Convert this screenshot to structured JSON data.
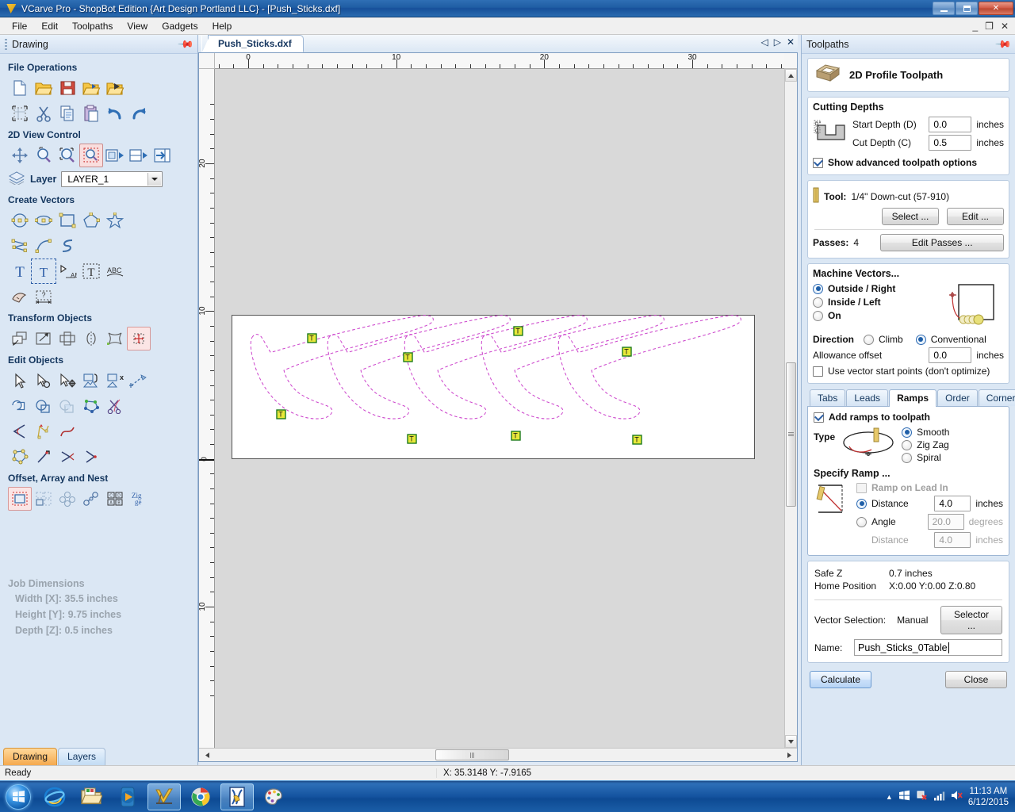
{
  "window": {
    "title": "VCarve Pro - ShopBot Edition {Art Design Portland LLC} - [Push_Sticks.dxf]",
    "minimize_label": "Minimize",
    "maximize_label": "Restore",
    "close_label": "Close",
    "inner_minimize": "_",
    "inner_restore": "❐",
    "inner_close": "✕"
  },
  "menu": {
    "items": [
      {
        "label": "File"
      },
      {
        "label": "Edit"
      },
      {
        "label": "Toolpaths"
      },
      {
        "label": "View"
      },
      {
        "label": "Gadgets"
      },
      {
        "label": "Help"
      }
    ]
  },
  "left_panel": {
    "title": "Drawing",
    "pin_label": "Pin panel",
    "sections": [
      {
        "title": "File Operations",
        "rows": [
          [
            "new-file-icon",
            "open-file-icon",
            "save-file-icon",
            "import-file-icon",
            "export-file-icon"
          ],
          [
            "job-setup-icon",
            "cut-icon",
            "copy-icon",
            "paste-icon",
            "undo-icon",
            "redo-icon"
          ]
        ]
      },
      {
        "title": "2D View Control",
        "rows": [
          [
            "pan-icon",
            "zoom-interactive-icon",
            "zoom-extents-icon",
            "zoom-box-icon",
            "zoom-selected-icon",
            "toggle-2d-3d-icon",
            "show-hide-panel-icon"
          ]
        ]
      },
      {
        "title": "Create Vectors",
        "rows": [
          [
            "draw-circle-icon",
            "draw-ellipse-icon",
            "draw-rectangle-icon",
            "draw-polygon-icon",
            "draw-star-icon"
          ],
          [
            "draw-polyline-icon",
            "draw-curve-icon",
            "draw-freehand-icon"
          ],
          [
            "create-text-icon",
            "edit-text-icon",
            "text-on-curve-icon",
            "text-block-icon",
            "auto-layout-text-icon"
          ],
          [
            "trace-bitmap-icon",
            "dimension-icon"
          ]
        ]
      },
      {
        "title": "Transform Objects",
        "rows": [
          [
            "move-objects-icon",
            "scale-objects-icon",
            "rotate-objects-icon",
            "mirror-objects-icon",
            "distort-objects-icon",
            "align-objects-icon"
          ]
        ]
      },
      {
        "title": "Edit Objects",
        "rows": [
          [
            "node-edit-icon",
            "node-edit-tools-icon",
            "move-node-icon",
            "group-objects-icon",
            "ungroup-objects-icon",
            "join-vectors-icon"
          ],
          [
            "weld-vectors-icon",
            "subtract-vectors-icon",
            "intersect-vectors-icon",
            "close-vector-icon",
            "trim-vectors-icon"
          ],
          [
            "fillet-icon",
            "curve-fit-icon",
            "smooth-curve-icon"
          ],
          [
            "offset-contour-icon",
            "corner-tool-1-icon",
            "corner-tool-2-icon",
            "corner-tool-3-icon"
          ]
        ]
      },
      {
        "title": "Offset, Array and Nest",
        "rows": [
          [
            "offset-vectors-icon",
            "block-copy-icon",
            "circular-copy-icon",
            "rotate-copy-icon",
            "plate-layout-icon",
            "nesting-icon"
          ]
        ]
      }
    ],
    "layer": {
      "label": "Layer",
      "icon": "layers-icon",
      "value": "LAYER_1",
      "options": [
        "LAYER_1"
      ]
    },
    "job_dimensions": {
      "title": "Job Dimensions",
      "lines": [
        "Width  [X]: 35.5 inches",
        "Height [Y]: 9.75 inches",
        "Depth  [Z]: 0.5 inches"
      ]
    },
    "tabs": [
      {
        "label": "Drawing",
        "active": true
      },
      {
        "label": "Layers",
        "active": false
      }
    ]
  },
  "document": {
    "tab_label": "Push_Sticks.dxf",
    "nav": {
      "prev": "◁",
      "next": "▷",
      "close": "✕"
    },
    "ruler_h": {
      "labels": [
        "0",
        "10",
        "20",
        "30"
      ],
      "label_positions": [
        0,
        10,
        20,
        30
      ],
      "min": -0.5,
      "max": 38
    },
    "ruler_v": {
      "labels": [
        "20",
        "10",
        "0",
        "10"
      ],
      "label_positions": [
        20,
        10,
        0,
        -10
      ]
    },
    "material": {
      "width_in": 35.5,
      "height_in": 9.75
    }
  },
  "toolpaths": {
    "title": "Toolpaths",
    "pin_label": "Pin panel",
    "header": {
      "icon": "profile-toolpath-icon",
      "name": "2D Profile Toolpath"
    },
    "cutting_depths": {
      "title": "Cutting Depths",
      "icon": "cut-depth-diagram-icon",
      "start_depth_label": "Start Depth (D)",
      "start_depth_value": "0.0",
      "start_depth_unit": "inches",
      "cut_depth_label": "Cut Depth (C)",
      "cut_depth_value": "0.5",
      "cut_depth_unit": "inches",
      "advanced_label": "Show advanced toolpath options",
      "advanced_checked": true
    },
    "tool": {
      "icon": "tool-bit-icon",
      "label": "Tool:",
      "name": "1/4\" Down-cut (57-910)",
      "select_button": "Select ...",
      "edit_button": "Edit ...",
      "passes_label": "Passes:",
      "passes_value": "4",
      "edit_passes_button": "Edit Passes ..."
    },
    "machine_vectors": {
      "title": "Machine Vectors...",
      "options": [
        {
          "label": "Outside / Right",
          "selected": true
        },
        {
          "label": "Inside / Left",
          "selected": false
        },
        {
          "label": "On",
          "selected": false
        }
      ],
      "direction_label": "Direction",
      "directions": [
        {
          "label": "Climb",
          "selected": false
        },
        {
          "label": "Conventional",
          "selected": true
        }
      ],
      "allowance_label": "Allowance offset",
      "allowance_value": "0.0",
      "allowance_unit": "inches",
      "start_points_label": "Use vector start points (don't optimize)",
      "start_points_checked": false,
      "diagram_icon": "vector-direction-diagram-icon"
    },
    "tabs": [
      {
        "label": "Tabs",
        "active": false
      },
      {
        "label": "Leads",
        "active": false
      },
      {
        "label": "Ramps",
        "active": true
      },
      {
        "label": "Order",
        "active": false
      },
      {
        "label": "Corners",
        "active": false
      }
    ],
    "ramps": {
      "add_ramps_label": "Add ramps to toolpath",
      "add_ramps_checked": true,
      "type_label": "Type",
      "type_icon": "ramp-type-diagram-icon",
      "types": [
        {
          "label": "Smooth",
          "selected": true
        },
        {
          "label": "Zig Zag",
          "selected": false
        },
        {
          "label": "Spiral",
          "selected": false
        }
      ],
      "specify_label": "Specify Ramp ...",
      "specify_icon": "ramp-distance-diagram-icon",
      "lead_in_label": "Ramp on Lead In",
      "lead_in_checked": false,
      "lead_in_disabled": true,
      "distance_label": "Distance",
      "distance_selected": true,
      "distance_value": "4.0",
      "distance_unit": "inches",
      "angle_label": "Angle",
      "angle_selected": false,
      "angle_value": "20.0",
      "angle_unit": "degrees",
      "angle_distance_label": "Distance",
      "angle_distance_value": "4.0",
      "angle_distance_unit": "inches"
    },
    "info": {
      "safe_z_label": "Safe Z",
      "safe_z_value": "0.7 inches",
      "home_label": "Home Position",
      "home_value": "X:0.00 Y:0.00 Z:0.80",
      "vector_selection_label": "Vector Selection:",
      "vector_selection_value": "Manual",
      "selector_button": "Selector ...",
      "name_label": "Name:",
      "name_value": "Push_Sticks_0Table"
    },
    "calculate_button": "Calculate",
    "close_button": "Close"
  },
  "statusbar": {
    "message": "Ready",
    "coordinates": "X: 35.3148 Y: -7.9165"
  },
  "taskbar": {
    "start_label": "start-orb-icon",
    "items": [
      {
        "name": "internet-explorer-icon",
        "active": false
      },
      {
        "name": "file-explorer-icon",
        "active": false
      },
      {
        "name": "media-player-icon",
        "active": false
      },
      {
        "name": "vcarve-pro-icon",
        "active": true
      },
      {
        "name": "google-chrome-icon",
        "active": false
      },
      {
        "name": "shopbot-icon",
        "active": true
      },
      {
        "name": "paint-icon",
        "active": false
      }
    ],
    "tray": {
      "overflow": "▲",
      "network_icon": "network-icon",
      "action_center_icon": "action-center-icon",
      "signal_icon": "signal-icon",
      "volume_icon": "volume-muted-icon"
    },
    "time": "11:13 AM",
    "date": "6/12/2015"
  },
  "colors": {
    "vector_outline": "#cc44cc",
    "tab_marker_fill": "#e8e83a",
    "accent_blue": "#1f5da3",
    "active_tab_orange": "#f5a94e"
  }
}
